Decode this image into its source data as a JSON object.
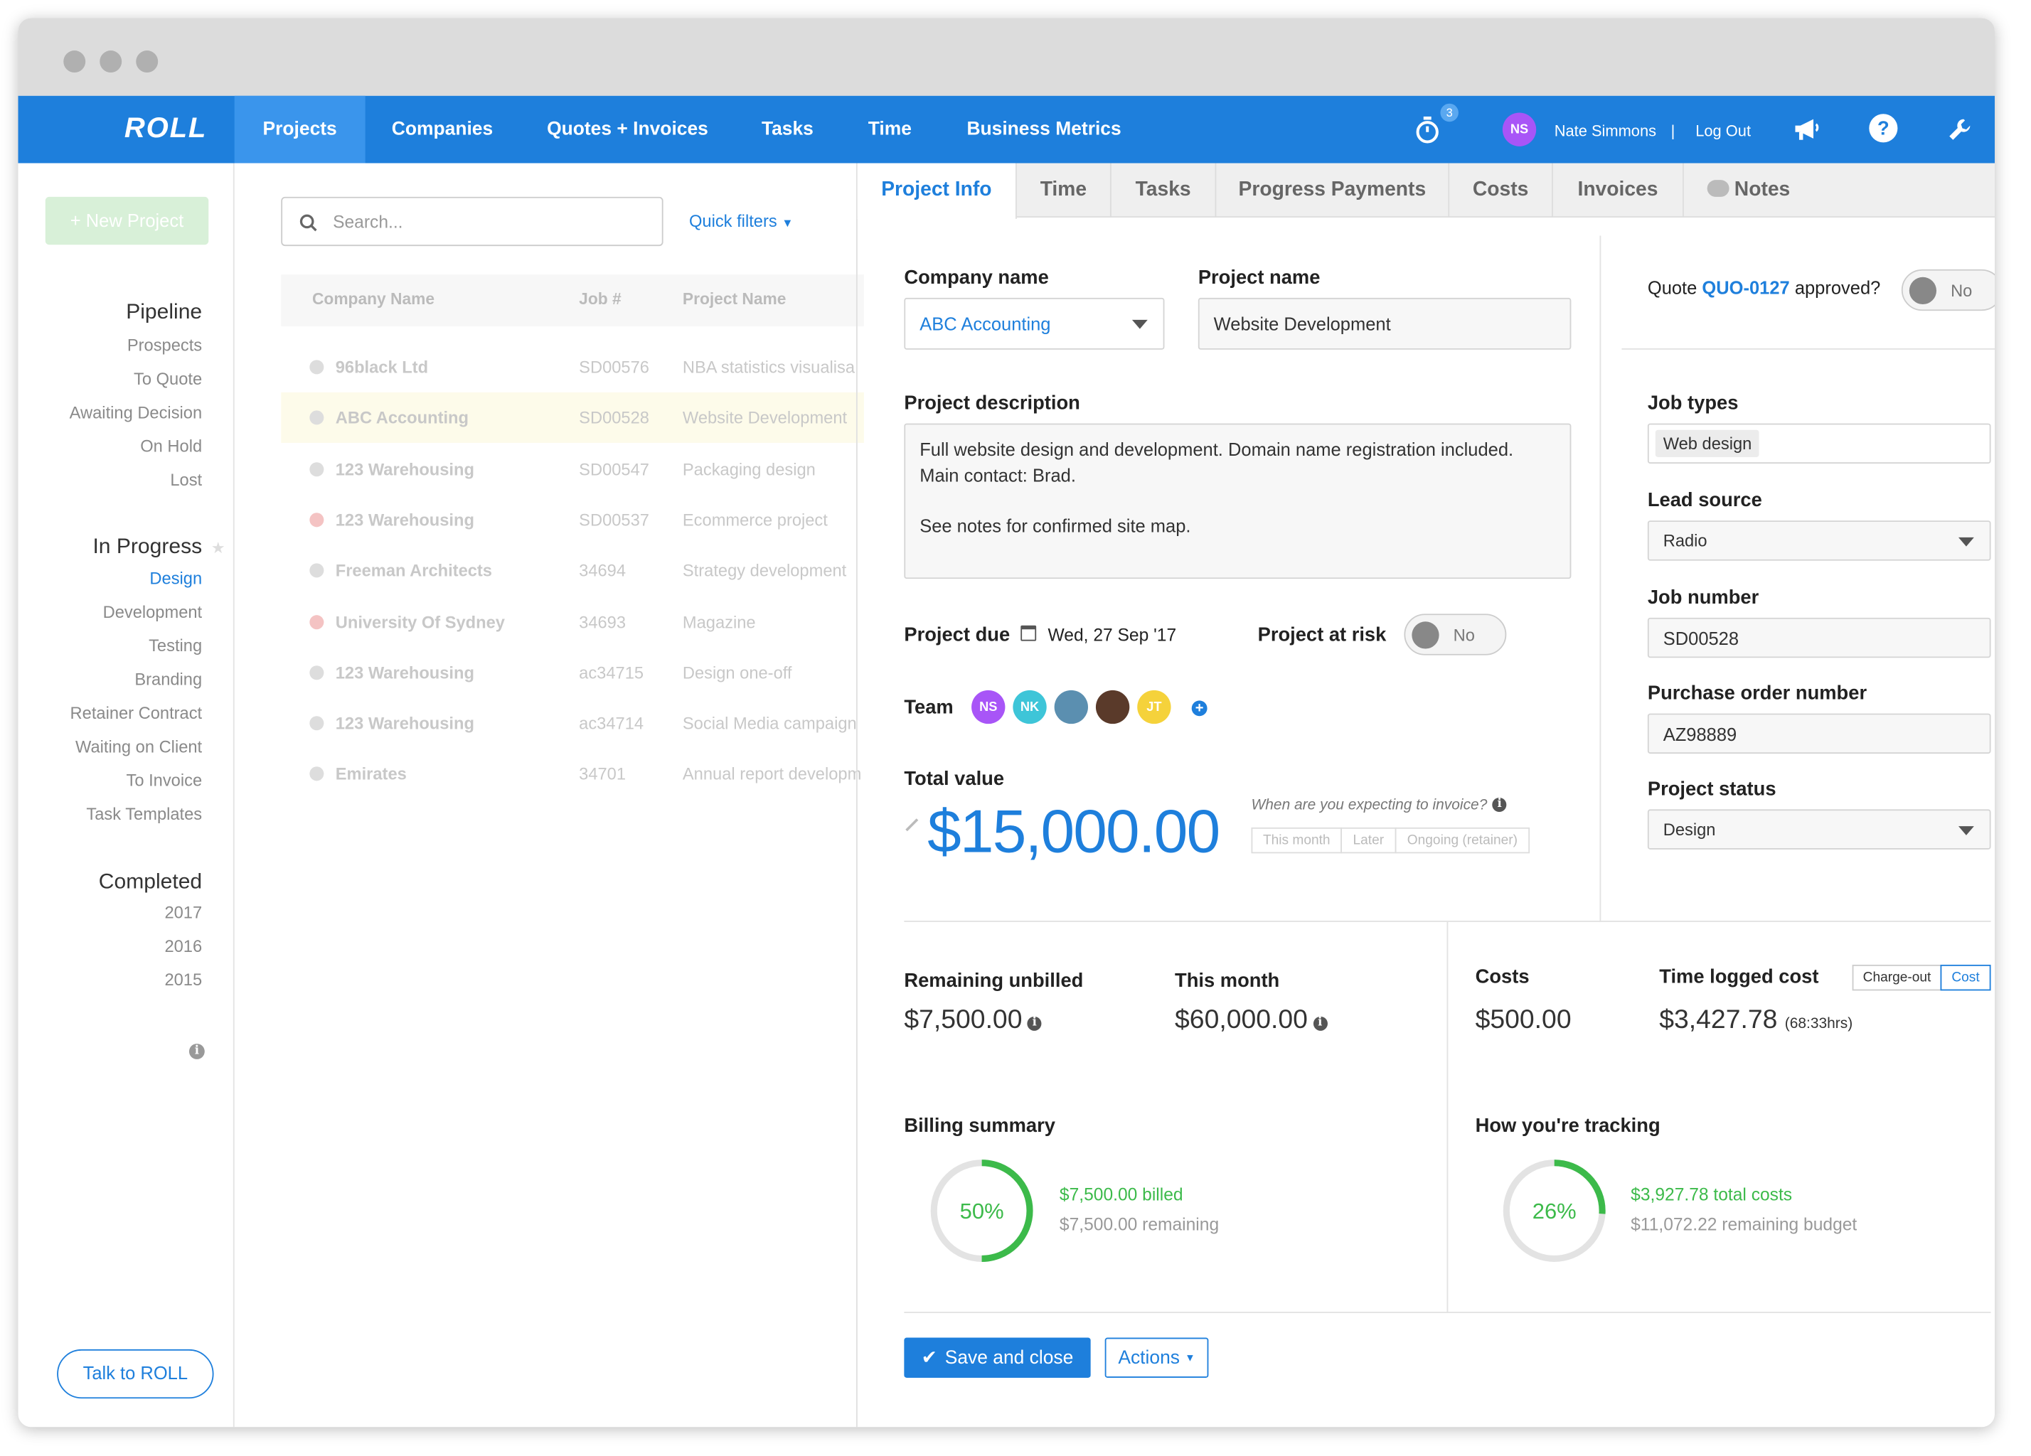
{
  "nav": {
    "logo": "ROLL",
    "items": [
      "Projects",
      "Companies",
      "Quotes + Invoices",
      "Tasks",
      "Time",
      "Business Metrics"
    ],
    "timer_badge": "3",
    "user_initials": "NS",
    "user_name": "Nate Simmons",
    "separator": "|",
    "logout": "Log Out"
  },
  "sidebar": {
    "new_project": "+ New Project",
    "pipeline_heading": "Pipeline",
    "pipeline_items": [
      "Prospects",
      "To Quote",
      "Awaiting Decision",
      "On Hold",
      "Lost"
    ],
    "in_progress_heading": "In Progress",
    "in_progress_items": [
      "Design",
      "Development",
      "Testing",
      "Branding",
      "Retainer Contract",
      "Waiting on Client",
      "To Invoice",
      "Task Templates"
    ],
    "completed_heading": "Completed",
    "completed_items": [
      "2017",
      "2016",
      "2015"
    ],
    "talk_button": "Talk to ROLL"
  },
  "list": {
    "search_placeholder": "Search...",
    "quick_filters": "Quick filters",
    "headers": [
      "Company Name",
      "Job #",
      "Project Name"
    ],
    "rows": [
      {
        "company": "96black Ltd",
        "job": "SD00576",
        "project": "NBA statistics visualisa",
        "status": "ok"
      },
      {
        "company": "ABC Accounting",
        "job": "SD00528",
        "project": "Website Development",
        "status": "ok",
        "selected": true
      },
      {
        "company": "123 Warehousing",
        "job": "SD00547",
        "project": "Packaging design",
        "status": "ok"
      },
      {
        "company": "123 Warehousing",
        "job": "SD00537",
        "project": "Ecommerce project",
        "status": "alert"
      },
      {
        "company": "Freeman Architects",
        "job": "34694",
        "project": "Strategy development",
        "status": "ok"
      },
      {
        "company": "University Of Sydney",
        "job": "34693",
        "project": "Magazine",
        "status": "alert"
      },
      {
        "company": "123 Warehousing",
        "job": "ac34715",
        "project": "Design one-off",
        "status": "ok"
      },
      {
        "company": "123 Warehousing",
        "job": "ac34714",
        "project": "Social Media campaign",
        "status": "ok"
      },
      {
        "company": "Emirates",
        "job": "34701",
        "project": "Annual report developm",
        "status": "ok"
      }
    ]
  },
  "tabs": [
    "Project Info",
    "Time",
    "Tasks",
    "Progress Payments",
    "Costs",
    "Invoices",
    "Notes"
  ],
  "form": {
    "company_label": "Company name",
    "company_value": "ABC Accounting",
    "project_label": "Project name",
    "project_value": "Website Development",
    "quote_prefix": "Quote",
    "quote_id": "QUO-0127",
    "quote_suffix": "approved?",
    "quote_toggle": "No",
    "desc_label": "Project description",
    "desc_line1": "Full website design and development. Domain name registration included.",
    "desc_line2": "Main contact: Brad.",
    "desc_line3": "See notes for confirmed site map.",
    "due_label": "Project due",
    "due_value": "Wed, 27 Sep '17",
    "risk_label": "Project at risk",
    "risk_toggle": "No",
    "team_label": "Team",
    "team": [
      {
        "initials": "NS",
        "color": "#a855f7"
      },
      {
        "initials": "NK",
        "color": "#3ec5d8"
      },
      {
        "initials": "",
        "color": "#5b8fb0"
      },
      {
        "initials": "",
        "color": "#5a3a2a"
      },
      {
        "initials": "JT",
        "color": "#f5d23b"
      }
    ],
    "total_label": "Total value",
    "total_value": "$15,000.00",
    "invoice_question": "When are you expecting to invoice?",
    "invoice_options": [
      "This month",
      "Later",
      "Ongoing (retainer)"
    ],
    "job_types_label": "Job types",
    "job_type_tag": "Web design",
    "lead_label": "Lead source",
    "lead_value": "Radio",
    "jobnum_label": "Job number",
    "jobnum_value": "SD00528",
    "po_label": "Purchase order number",
    "po_value": "AZ98889",
    "status_label": "Project status",
    "status_value": "Design"
  },
  "stats": {
    "remaining_label": "Remaining unbilled",
    "remaining_value": "$7,500.00",
    "month_label": "This month",
    "month_value": "$60,000.00",
    "costs_label": "Costs",
    "costs_value": "$500.00",
    "time_label": "Time logged cost",
    "time_value": "$3,427.78",
    "time_hours": "(68:33hrs)",
    "toggle_options": [
      "Charge-out",
      "Cost"
    ],
    "billing_label": "Billing summary",
    "billing_percent": "50%",
    "billing_fraction": 0.5,
    "billed": "$7,500.00 billed",
    "billing_remaining": "$7,500.00 remaining",
    "tracking_label": "How you're tracking",
    "tracking_percent": "26%",
    "tracking_fraction": 0.26,
    "total_costs": "$3,927.78 total costs",
    "remaining_budget": "$11,072.22 remaining budget"
  },
  "footer": {
    "save": "Save and close",
    "actions": "Actions"
  },
  "colors": {
    "accent": "#1e7fdc",
    "green": "#3cba4a"
  }
}
